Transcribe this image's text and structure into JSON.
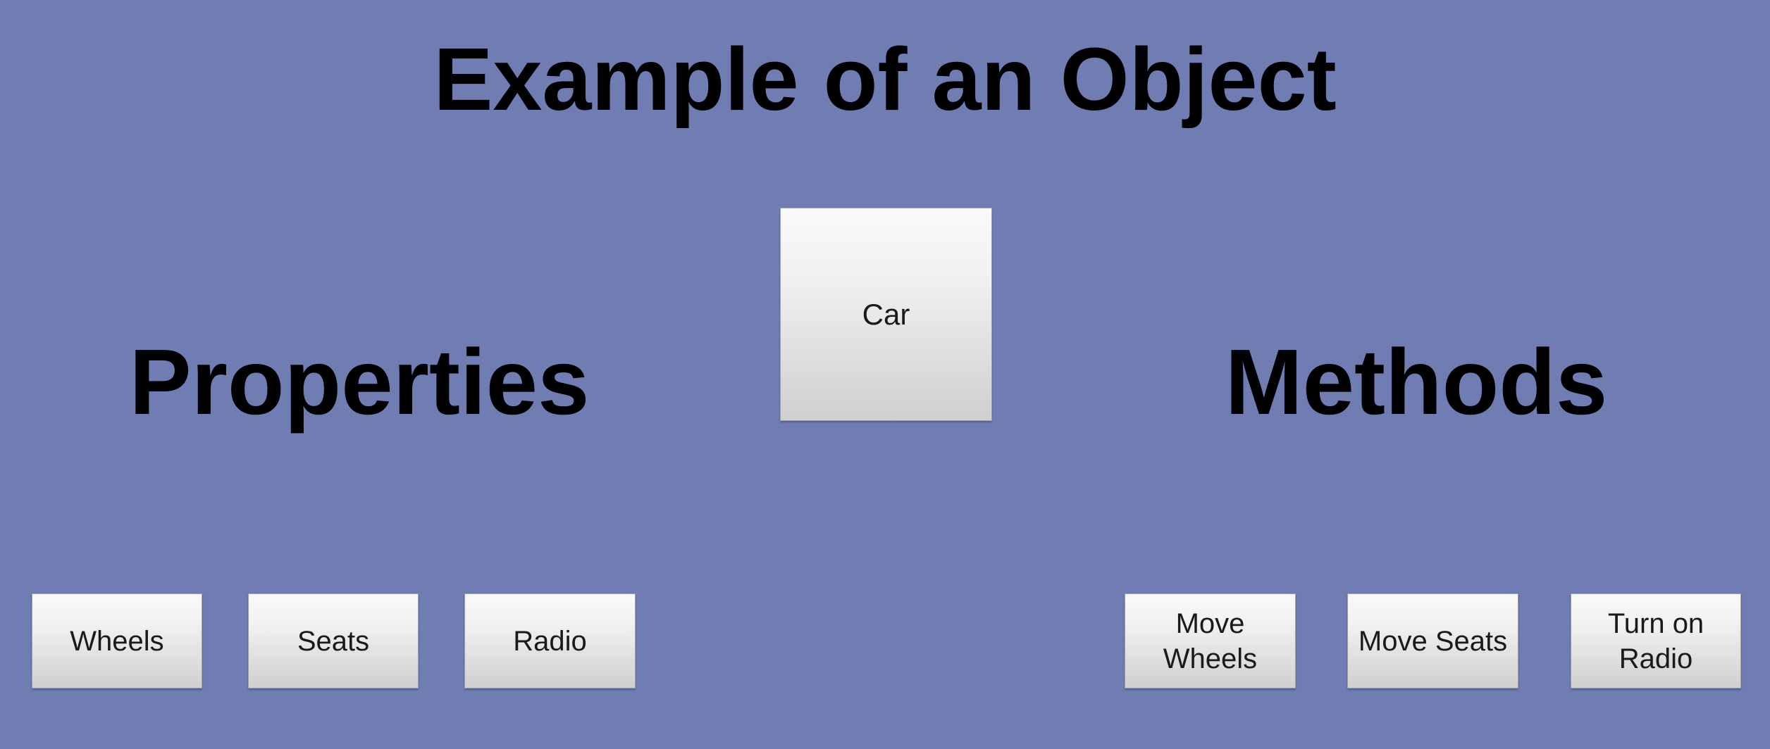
{
  "title": "Example of an Object",
  "object": {
    "label": "Car"
  },
  "properties": {
    "heading": "Properties",
    "items": [
      "Wheels",
      "Seats",
      "Radio"
    ]
  },
  "methods": {
    "heading": "Methods",
    "items": [
      "Move\nWheels",
      "Move Seats",
      "Turn on\nRadio"
    ]
  },
  "colors": {
    "background": "#6f7db2",
    "box_top": "#fafafa",
    "box_bottom": "#cfcfcf",
    "text": "#000000"
  }
}
